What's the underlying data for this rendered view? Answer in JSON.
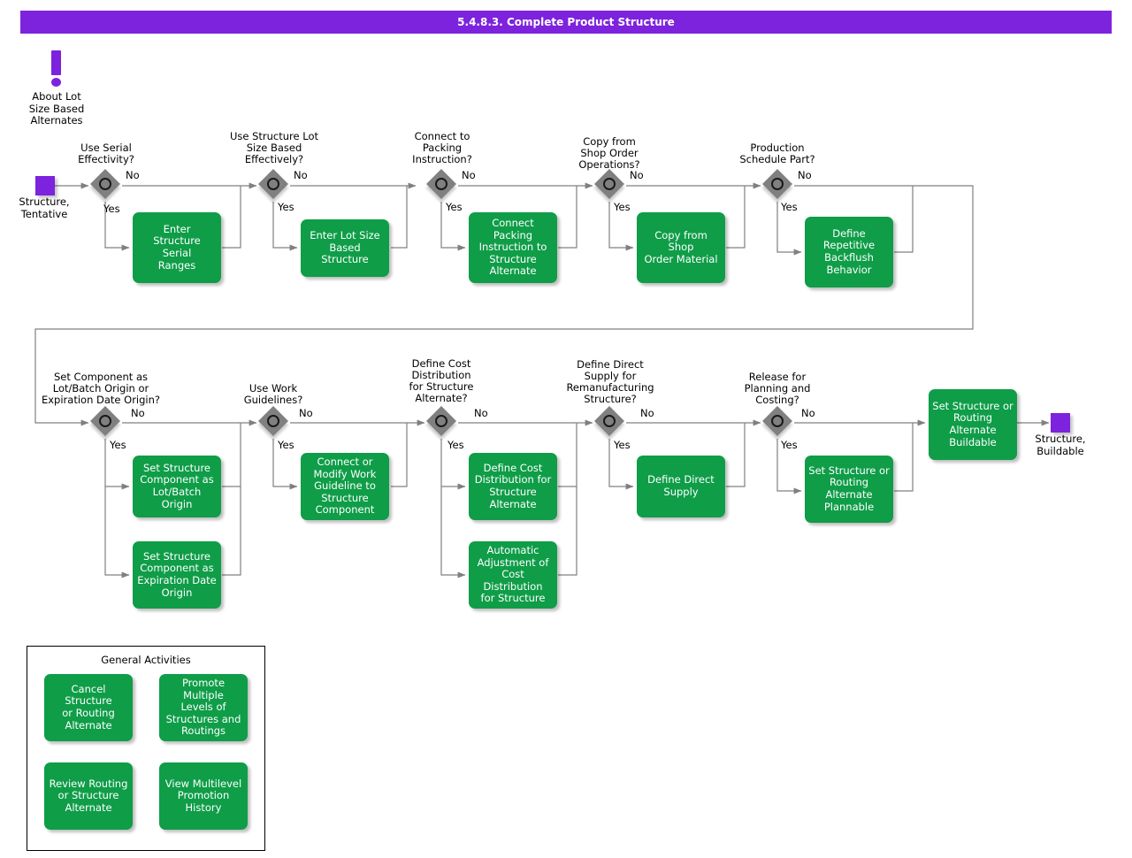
{
  "header": {
    "title": "5.4.8.3. Complete Product Structure",
    "accent_color": "#7d22dd"
  },
  "colors": {
    "activity_green": "#0f9d48",
    "terminator_purple": "#7d22dd",
    "decision_gray": "#808080",
    "connector_gray": "#808080",
    "text_dark": "#000000"
  },
  "note": {
    "icon": "exclamation-icon",
    "label": "About Lot\nSize Based\nAlternates"
  },
  "terminators": {
    "start": {
      "label": "Structure,\nTentative"
    },
    "end": {
      "label": "Structure,\nBuildable"
    }
  },
  "edge_labels": {
    "yes": "Yes",
    "no": "No"
  },
  "row1": {
    "decisions": [
      {
        "id": "use-serial-effectivity",
        "question": "Use Serial\nEffectivity?"
      },
      {
        "id": "use-structure-lot-size-based-effectively",
        "question": "Use Structure Lot\nSize Based\nEffectively?"
      },
      {
        "id": "connect-to-packing-instruction",
        "question": "Connect to\nPacking\nInstruction?"
      },
      {
        "id": "copy-from-shop-order-operations",
        "question": "Copy from\nShop Order\nOperations?"
      },
      {
        "id": "production-schedule-part",
        "question": "Production\nSchedule Part?"
      }
    ],
    "activities": [
      {
        "id": "enter-structure-serial-ranges",
        "label": "Enter\nStructure\nSerial\nRanges"
      },
      {
        "id": "enter-lot-size-based-structure",
        "label": "Enter Lot Size\nBased\nStructure"
      },
      {
        "id": "connect-packing-instruction-to-structure-alternate",
        "label": "Connect Packing\nInstruction to\nStructure\nAlternate"
      },
      {
        "id": "copy-from-shop-order-material",
        "label": "Copy from Shop\nOrder Material"
      },
      {
        "id": "define-repetitive-backflush-behavior",
        "label": "Define\nRepetitive\nBackflush\nBehavior"
      }
    ]
  },
  "row2": {
    "decisions": [
      {
        "id": "set-component-as-lot-batch-origin",
        "question": "Set Component as\nLot/Batch Origin or\nExpiration Date Origin?"
      },
      {
        "id": "use-work-guidelines",
        "question": "Use Work\nGuidelines?"
      },
      {
        "id": "define-cost-distribution-for-structure-alternate",
        "question": "Define Cost\nDistribution\nfor Structure\nAlternate?"
      },
      {
        "id": "define-direct-supply-for-remanufacturing-structure",
        "question": "Define Direct\nSupply for\nRemanufacturing\nStructure?"
      },
      {
        "id": "release-for-planning-and-costing",
        "question": "Release for\nPlanning and\nCosting?"
      }
    ],
    "activities": [
      {
        "id": "set-structure-component-as-lot-batch-origin",
        "label": "Set Structure\nComponent as\nLot/Batch\nOrigin"
      },
      {
        "id": "set-structure-component-as-expiration-date-origin",
        "label": "Set Structure\nComponent as\nExpiration Date\nOrigin"
      },
      {
        "id": "connect-or-modify-work-guideline-to-structure-component",
        "label": "Connect or\nModify Work\nGuideline to\nStructure\nComponent"
      },
      {
        "id": "define-cost-distribution-for-structure-alternate",
        "label": "Define Cost\nDistribution for\nStructure\nAlternate"
      },
      {
        "id": "automatic-adjustment-of-cost-distribution-for-structure",
        "label": "Automatic\nAdjustment of\nCost Distribution\nfor Structure"
      },
      {
        "id": "define-direct-supply",
        "label": "Define Direct\nSupply"
      },
      {
        "id": "set-structure-or-routing-alternate-plannable",
        "label": "Set Structure or\nRouting\nAlternate\nPlannable"
      },
      {
        "id": "set-structure-or-routing-alternate-buildable",
        "label": "Set Structure or\nRouting\nAlternate\nBuildable"
      }
    ]
  },
  "legend": {
    "title": "General Activities",
    "items": [
      {
        "id": "cancel-structure-or-routing-alternate",
        "label": "Cancel Structure\nor Routing\nAlternate"
      },
      {
        "id": "promote-multiple-levels-of-structures-and-routings",
        "label": "Promote Multiple\nLevels of\nStructures and\nRoutings"
      },
      {
        "id": "review-routing-or-structure-alternate",
        "label": "Review Routing\nor Structure\nAlternate"
      },
      {
        "id": "view-multilevel-promotion-history",
        "label": "View Multilevel\nPromotion\nHistory"
      }
    ]
  }
}
